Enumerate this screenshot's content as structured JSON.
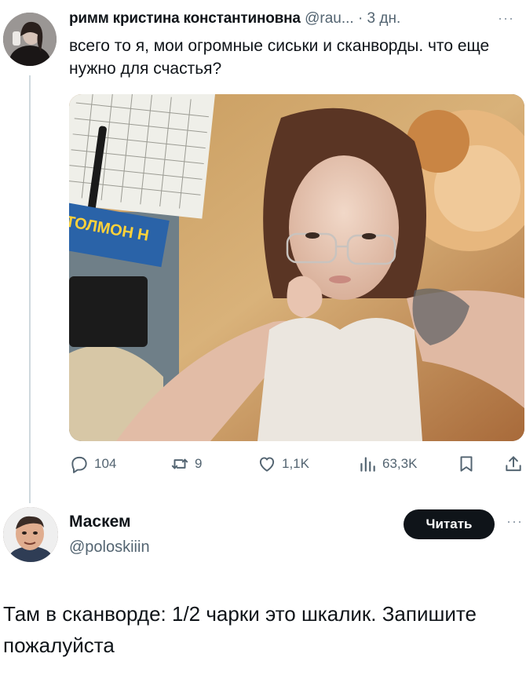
{
  "tweet": {
    "author_name": "римм кристина константиновна",
    "handle_time": "@rau... · 3 дн.",
    "text": "всего то я, мои огромные сиськи и сканворды. что еще нужно для счастья?",
    "more_label": "···",
    "actions": {
      "replies": "104",
      "retweets": "9",
      "likes": "1,1K",
      "views": "63,3K"
    },
    "media_text": {
      "book_title": "ТОЛМОН Н"
    }
  },
  "reply": {
    "author_name": "Маскем",
    "handle": "@poloskiiin",
    "follow_label": "Читать",
    "more_label": "···",
    "text": "Там в сканворде: 1/2 чарки это шкалик. Запишите пожалуйста"
  },
  "icons": {
    "reply": "comment-icon",
    "retweet": "retweet-icon",
    "like": "heart-icon",
    "views": "views-chart-icon",
    "bookmark": "bookmark-icon",
    "share": "share-icon"
  },
  "colors": {
    "text_primary": "#0f1419",
    "text_secondary": "#536471",
    "button_bg": "#0f1419",
    "thread_line": "#cfd9de"
  }
}
